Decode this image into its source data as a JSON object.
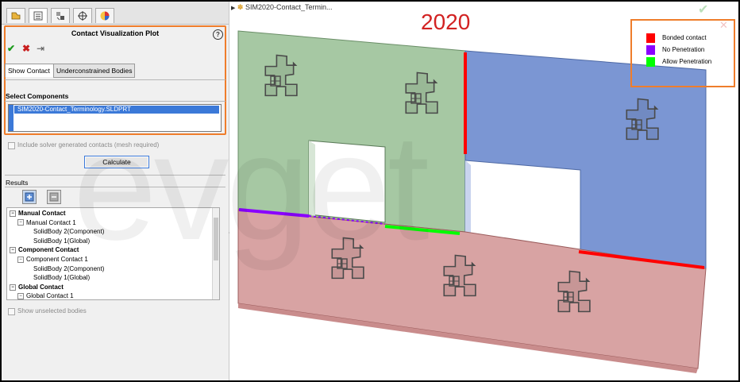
{
  "property_manager": {
    "tabs": [
      "feature-manager-tab",
      "property-manager-tab",
      "configuration-manager-tab",
      "dimxpert-tab",
      "display-manager-tab"
    ],
    "title": "Contact Visualization Plot",
    "help_glyph": "?",
    "ok_glyph": "✔",
    "cancel_glyph": "✖",
    "pin_glyph": "⇥",
    "subtabs": [
      "Show Contact",
      "Underconstrained Bodies"
    ],
    "select_components": {
      "heading": "Select Components",
      "items": [
        "SIM2020-Contact_Terminology.SLDPRT"
      ]
    },
    "include_solver_label": "Include solver generated contacts (mesh required)",
    "calculate_label": "Calculate",
    "results": {
      "heading": "Results",
      "tree": [
        {
          "label": "Manual Contact",
          "level": 0,
          "bold": true,
          "expander": "−"
        },
        {
          "label": "Manual Contact 1",
          "level": 1,
          "bold": false,
          "expander": "−"
        },
        {
          "label": "SolidBody 2(Component)",
          "level": 2,
          "bold": false,
          "expander": ""
        },
        {
          "label": "SolidBody 1(Global)",
          "level": 2,
          "bold": false,
          "expander": ""
        },
        {
          "label": "Component Contact",
          "level": 0,
          "bold": true,
          "expander": "−"
        },
        {
          "label": "Component Contact 1",
          "level": 1,
          "bold": false,
          "expander": "−"
        },
        {
          "label": "SolidBody 2(Component)",
          "level": 2,
          "bold": false,
          "expander": ""
        },
        {
          "label": "SolidBody 1(Global)",
          "level": 2,
          "bold": false,
          "expander": ""
        },
        {
          "label": "Global Contact",
          "level": 0,
          "bold": true,
          "expander": "−"
        },
        {
          "label": "Global Contact 1",
          "level": 1,
          "bold": false,
          "expander": "−"
        }
      ]
    },
    "show_unselected_label": "Show unselected bodies"
  },
  "graphics": {
    "document_tab": "SIM2020-Contact_Termin...",
    "year_label": "2020",
    "watermark": "evget",
    "legend": [
      {
        "label": "Bonded contact",
        "color": "#ff0000"
      },
      {
        "label": "No Penetration",
        "color": "#8a00ff"
      },
      {
        "label": "Allow Penetration",
        "color": "#00ff00"
      }
    ],
    "confirm_glyph": "✔",
    "close_glyph": "✕"
  },
  "colors": {
    "highlight": "#ef7d2b",
    "green_body": "#a6c8a3",
    "blue_body": "#7b96d3",
    "red_body": "#d8a3a3"
  }
}
